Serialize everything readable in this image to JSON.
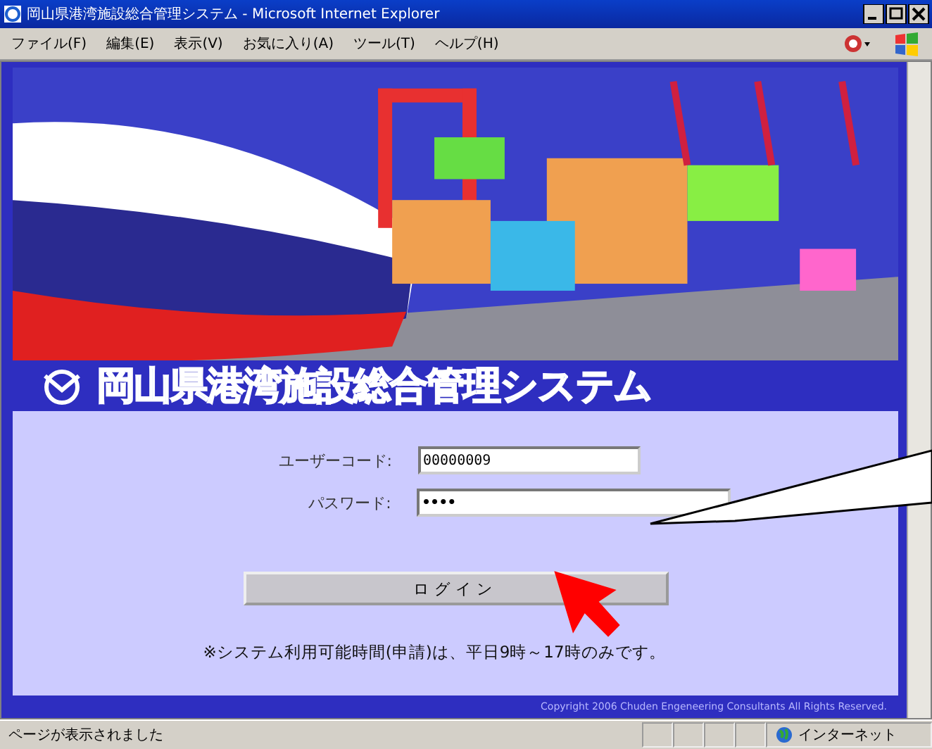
{
  "window": {
    "title": "岡山県港湾施設総合管理システム - Microsoft Internet Explorer"
  },
  "menu": [
    "ファイル(F)",
    "編集(E)",
    "表示(V)",
    "お気に入り(A)",
    "ツール(T)",
    "ヘルプ(H)"
  ],
  "banner": {
    "kind": "picture",
    "heading": "岡山県港湾施設総合管理システム"
  },
  "form": {
    "fields": [
      {
        "label": "ユーザーコード:",
        "value": "00000009",
        "kind": "text"
      },
      {
        "label": "パスワード:",
        "value": "••••",
        "kind": "password"
      }
    ],
    "button": "ログイン",
    "note": "※システム利用可能時間(申請)は、平日9時～17時のみです。"
  },
  "copyright": "Copyright  2006 Chuden Engeneering Consultants All Rights Reserved.",
  "status_bar": {
    "message": "ページが表示されました",
    "zone": "インターネット"
  }
}
